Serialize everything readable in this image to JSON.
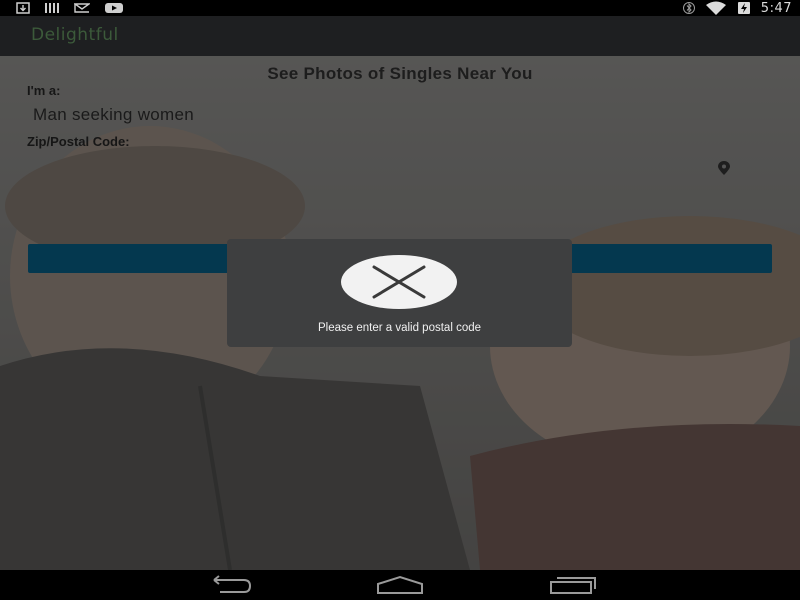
{
  "status_bar": {
    "time": "5:47",
    "left_icons": [
      "download-icon",
      "barcode-icon",
      "mail-outline-icon",
      "youtube-icon"
    ],
    "right_icons": [
      "bluetooth-icon",
      "wifi-icon",
      "battery-charging-icon"
    ]
  },
  "app_bar": {
    "title": "Delightful"
  },
  "form": {
    "headline": "See Photos of Singles Near You",
    "iam_label": "I'm a:",
    "seeking_value": "Man seeking women",
    "zip_label": "Zip/Postal Code:",
    "zip_value": "",
    "location_icon": "location-pin-icon",
    "submit_label": "",
    "submit_color": "#04384f"
  },
  "toast": {
    "message": "Please enter a valid postal code",
    "icon": "close-icon"
  },
  "nav_bar": {
    "buttons": [
      "back-icon",
      "home-icon",
      "recents-icon"
    ]
  }
}
